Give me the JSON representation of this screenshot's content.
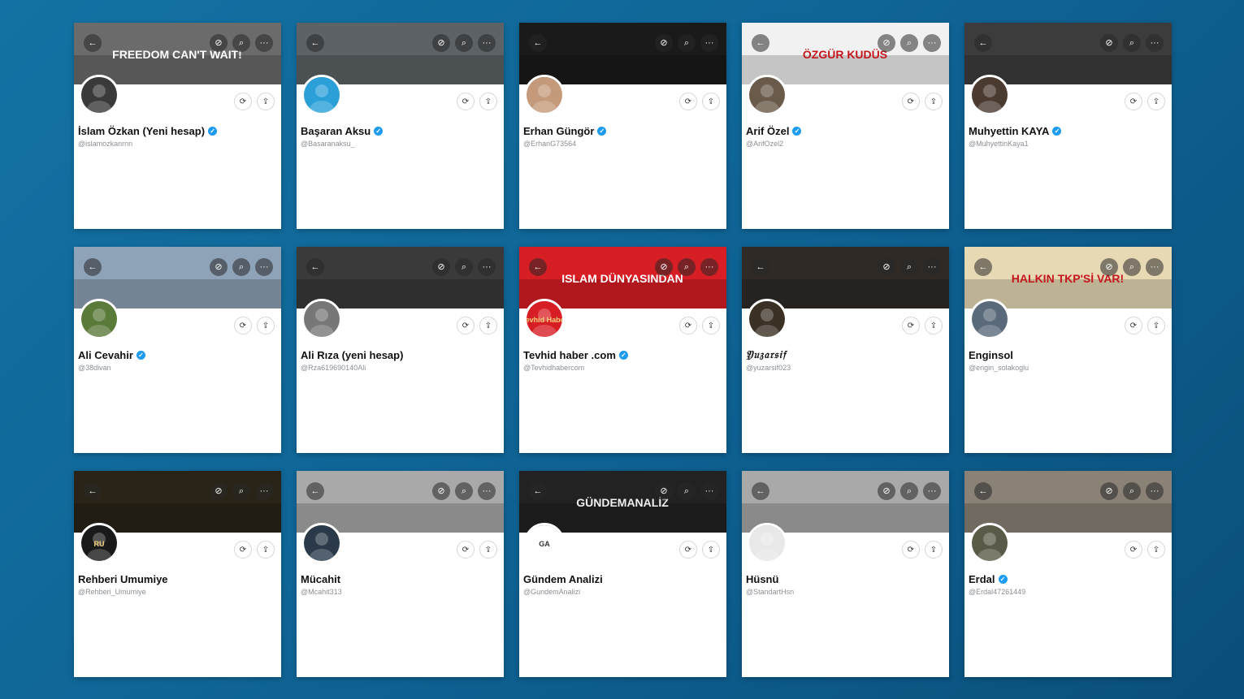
{
  "icons": {
    "back": "←",
    "sync": "⊘",
    "search": "⌕",
    "more": "···",
    "refresh": "⟳",
    "share": "⇪",
    "verified": "✓"
  },
  "cards": [
    {
      "name": "İslam Özkan (Yeni hesap)",
      "handle": "@islamozkanrnn",
      "verified": true,
      "banner_text": "FREEDOM CAN'T WAIT!",
      "banner_color": "#6b6b6b",
      "avatar_color": "#3a3a3a"
    },
    {
      "name": "Başaran Aksu",
      "handle": "@Basaranaksu_",
      "verified": true,
      "banner_text": "",
      "banner_color": "#5c6266",
      "avatar_color": "#2a9fd8"
    },
    {
      "name": "Erhan Güngör",
      "handle": "@ErhanG73564",
      "verified": true,
      "banner_text": "",
      "banner_color": "#1a1a1a",
      "avatar_color": "#c49a7a"
    },
    {
      "name": "Arif Özel",
      "handle": "@ArifOzel2",
      "verified": true,
      "banner_text": "ÖZGÜR KUDÜS",
      "banner_color": "#f1f1f1",
      "avatar_color": "#6a5a4a"
    },
    {
      "name": "Muhyettin KAYA",
      "handle": "@MuhyettinKaya1",
      "verified": true,
      "banner_text": "",
      "banner_color": "#3c3c3c",
      "avatar_color": "#4a3a30"
    },
    {
      "name": "Ali Cevahir",
      "handle": "@38divan",
      "verified": true,
      "banner_text": "",
      "banner_color": "#8fa3b8",
      "avatar_color": "#5a7a3a"
    },
    {
      "name": "Ali Rıza (yeni hesap)",
      "handle": "@Rza619690140Ali",
      "verified": false,
      "banner_text": "",
      "banner_color": "#3a3a3a",
      "avatar_color": "#777777"
    },
    {
      "name": "Tevhid haber .com",
      "handle": "@Tevhidhabercom",
      "verified": true,
      "banner_text": "ISLAM DÜNYASINDAN",
      "banner_color": "#d81e25",
      "avatar_color": "#d81e25",
      "avatar_text": "Tevhid Haber"
    },
    {
      "name": "𝔜𝔲𝔷𝔞𝔯𝔰𝔦𝔣",
      "handle": "@yuzarsif023",
      "verified": false,
      "banner_text": "",
      "banner_color": "#2f2a26",
      "avatar_color": "#3a3024"
    },
    {
      "name": "Enginsol",
      "handle": "@engin_solakoglu",
      "verified": false,
      "banner_text": "HALKIN TKP'Sİ VAR!",
      "banner_color": "#e8d9b5",
      "avatar_color": "#5a6a7a"
    },
    {
      "name": "Rehberi Umumiye",
      "handle": "@Rehberi_Umumiye",
      "verified": false,
      "banner_text": "",
      "banner_color": "#2a2418",
      "avatar_color": "#1a1a1a",
      "avatar_text": "RU"
    },
    {
      "name": "Mücahit",
      "handle": "@Mcahit313",
      "verified": false,
      "banner_text": "",
      "banner_color": "#a9a9a9",
      "avatar_color": "#2a3a4a"
    },
    {
      "name": "Gündem Analizi",
      "handle": "@GundemAnalizi",
      "verified": false,
      "banner_text": "GÜNDEMANALİZ",
      "banner_color": "#222222",
      "avatar_color": "#ffffff",
      "avatar_text": "GA"
    },
    {
      "name": "Hüsnü",
      "handle": "@StandartHsn",
      "verified": false,
      "banner_text": "",
      "banner_color": "#a9a9a9",
      "avatar_color": "#e8e8e8"
    },
    {
      "name": "Erdal",
      "handle": "@Erdal47261449",
      "verified": true,
      "banner_text": "",
      "banner_color": "#8a8276",
      "avatar_color": "#5a5a48"
    }
  ]
}
